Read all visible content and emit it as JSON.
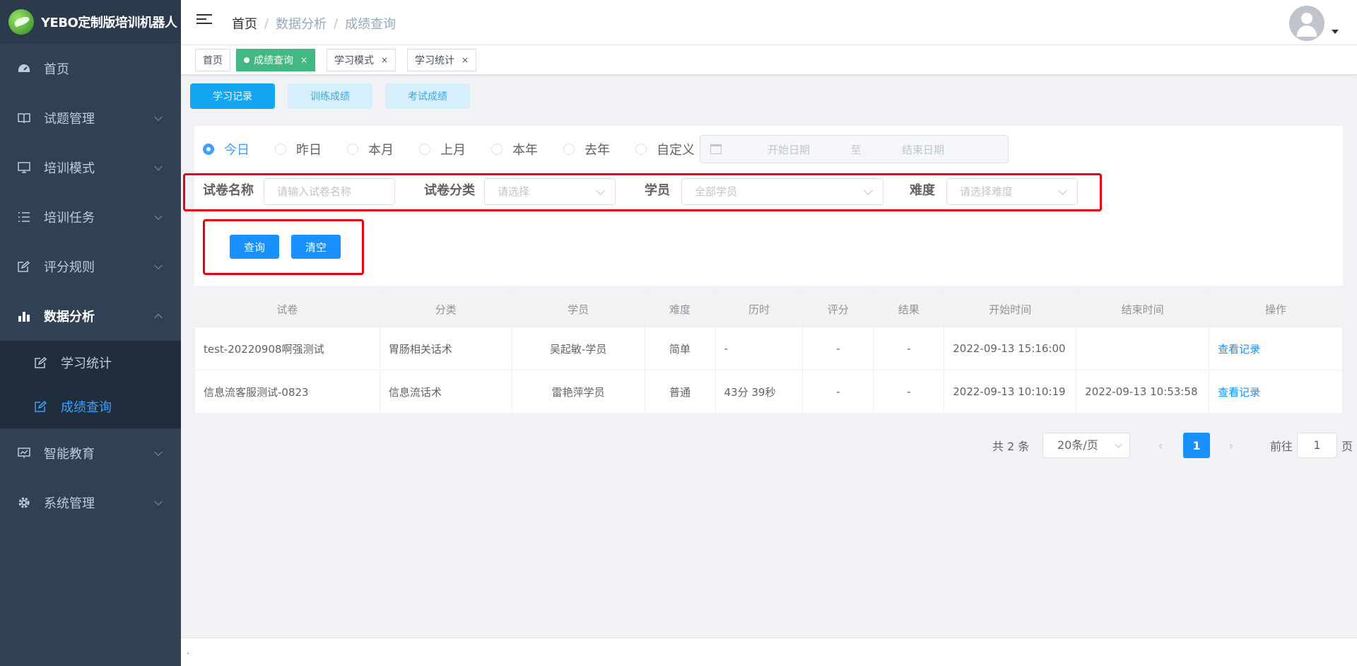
{
  "app": {
    "title": "YEBO定制版培训机器人"
  },
  "sidebar": {
    "items": [
      {
        "label": "首页",
        "icon": "dashboard-icon"
      },
      {
        "label": "试题管理",
        "icon": "book-icon"
      },
      {
        "label": "培训模式",
        "icon": "monitor-icon"
      },
      {
        "label": "培训任务",
        "icon": "list-icon"
      },
      {
        "label": "评分规则",
        "icon": "edit-icon"
      },
      {
        "label": "数据分析",
        "icon": "bar-chart-icon"
      },
      {
        "label": "智能教育",
        "icon": "presentation-icon"
      },
      {
        "label": "系统管理",
        "icon": "gear-icon"
      }
    ],
    "sub_items": [
      {
        "label": "学习统计",
        "icon": "edit-icon"
      },
      {
        "label": "成绩查询",
        "icon": "edit-icon"
      }
    ]
  },
  "header": {
    "breadcrumb": [
      "首页",
      "数据分析",
      "成绩查询"
    ],
    "separator": "/"
  },
  "tags": [
    {
      "label": "首页"
    },
    {
      "label": "成绩查询",
      "close": "×"
    },
    {
      "label": "学习模式",
      "close": "×"
    },
    {
      "label": "学习统计",
      "close": "×"
    }
  ],
  "subtabs": [
    "学习记录",
    "训练成绩",
    "考试成绩"
  ],
  "filters": {
    "radios": [
      "今日",
      "昨日",
      "本月",
      "上月",
      "本年",
      "去年",
      "自定义"
    ],
    "selected_radio": "今日",
    "date_start_placeholder": "开始日期",
    "date_to": "至",
    "date_end_placeholder": "结束日期",
    "paper_name_label": "试卷名称",
    "paper_name_placeholder": "请输入试卷名称",
    "paper_category_label": "试卷分类",
    "paper_category_placeholder": "请选择",
    "student_label": "学员",
    "student_placeholder": "全部学员",
    "difficulty_label": "难度",
    "difficulty_placeholder": "请选择难度",
    "search_button": "查询",
    "clear_button": "清空"
  },
  "table": {
    "headers": [
      "试卷",
      "分类",
      "学员",
      "难度",
      "历时",
      "评分",
      "结果",
      "开始时间",
      "结束时间",
      "操作"
    ],
    "rows": [
      [
        "test-20220908啊强测试",
        "胃肠相关话术",
        "吴起敏-学员",
        "简单",
        "-",
        "-",
        "-",
        "2022-09-13 15:16:00",
        "",
        "查看记录"
      ],
      [
        "信息流客服测试-0823",
        "信息流话术",
        "雷艳萍学员",
        "普通",
        "43分 39秒",
        "-",
        "-",
        "2022-09-13 10:10:19",
        "2022-09-13 10:53:58",
        "查看记录"
      ]
    ]
  },
  "pagination": {
    "total_text": "共 2 条",
    "page_size": "20条/页",
    "prev": "‹",
    "next": "›",
    "current_page": "1",
    "goto_label": "前往",
    "goto_value": "1",
    "page_suffix": "页"
  },
  "footer": {
    "text": "."
  },
  "colors": {
    "sidebar_bg": "#304156",
    "accent": "#409eff",
    "tag_active": "#42b983",
    "highlight": "#e60012"
  }
}
